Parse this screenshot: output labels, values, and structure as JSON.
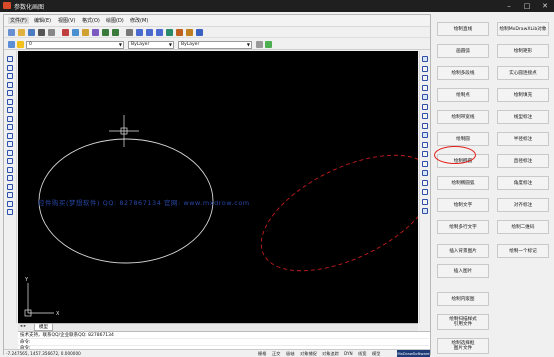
{
  "window": {
    "title": "参数化画图",
    "minimize": "–",
    "maximize": "□",
    "close": "✕"
  },
  "menu": [
    "文件(F)",
    "编辑(E)",
    "视图(V)",
    "格式(O)",
    "绘图(D)",
    "修改(M)"
  ],
  "toolbar": {
    "layer_value": "0",
    "color_value": "ByLayer",
    "linetype_value": "ByLayer"
  },
  "toolbar_icons": [
    "new-icon",
    "open-icon",
    "save-icon",
    "print-icon",
    "preview-icon",
    "cut-icon",
    "copy-icon",
    "paste-icon",
    "match-icon",
    "undo-icon",
    "redo-icon",
    "pan-icon",
    "zoom-realtime-icon",
    "zoom-window-icon",
    "zoom-prev-icon",
    "properties-icon",
    "design-center-icon",
    "tool-palette-icon",
    "help-icon"
  ],
  "left_tools": [
    "line-icon",
    "xline-icon",
    "pline-icon",
    "polygon-icon",
    "rectangle-icon",
    "arc-icon",
    "circle-icon",
    "cloud-icon",
    "spline-icon",
    "ellipse-icon",
    "ellipse-arc-icon",
    "insert-icon",
    "block-icon",
    "point-icon",
    "hatch-icon",
    "gradient-icon",
    "region-icon",
    "table-icon",
    "mtext-icon"
  ],
  "right_tools": [
    "erase-icon",
    "copy-obj-icon",
    "mirror-icon",
    "offset-icon",
    "array-icon",
    "move-icon",
    "rotate-icon",
    "scale-icon",
    "stretch-icon",
    "trim-icon",
    "extend-icon",
    "break-point-icon",
    "break-icon",
    "join-icon",
    "chamfer-icon",
    "fillet-icon",
    "explode-icon"
  ],
  "drawing": {
    "watermark": "控件购买(梦想软件)  QQ: 827867134  官网: www.mxdrow.com",
    "ucs_x": "X",
    "ucs_y": "Y"
  },
  "tabs": {
    "arrows": "◂ ▸",
    "model_tab": "模型"
  },
  "command": {
    "line1": "技术支持，联系QQ/企业联系QQ: 827867134",
    "line2": "命令:",
    "line3": "命令:"
  },
  "status": {
    "coords": "-7.247565, 1457.356672, 0.000000",
    "toggles": [
      "栅格",
      "正交",
      "极轴",
      "对象捕捉",
      "对象追踪",
      "DYN",
      "线宽",
      "模型"
    ],
    "logo": "MxDrawSoftware"
  },
  "buttons": [
    "绘制直线",
    "绘制MxDrawXLib对象",
    "画圆弧",
    "绘制矩形",
    "绘制多段线",
    "实心圆连接点",
    "绘制点",
    "绘制填充",
    "绘制带宽线",
    "线型标注",
    "绘制圆",
    "半径标注",
    "绘制椭圆",
    "直径标注",
    "绘制椭圆弧",
    "角度标注",
    "绘制文字",
    "对齐标注",
    "绘制多行文字",
    "绘制二维码",
    "插入背景图片",
    "绘制一个标记",
    "插入图片",
    "绘制内嵌图",
    "绘制扫描样式\n引用文件",
    "绘制选择框\n图片文件"
  ],
  "colors": {
    "canvas": "#000000",
    "entity": "#d8d8d8",
    "selected": "#c41c1c",
    "highlight": "#e0201a"
  }
}
